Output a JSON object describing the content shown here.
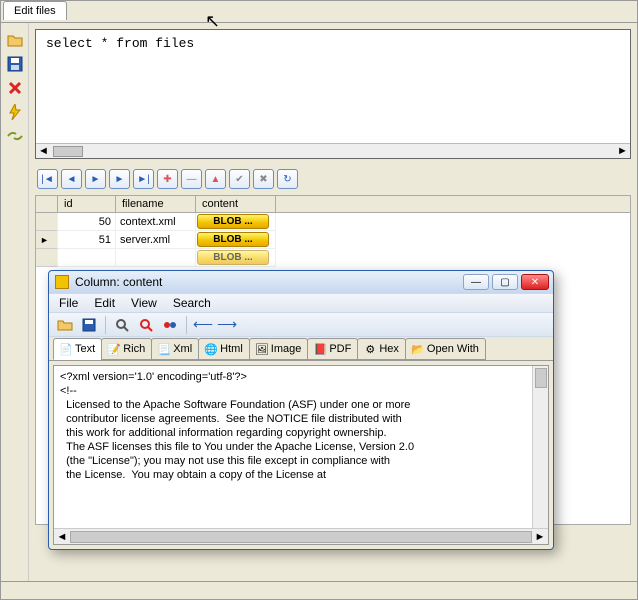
{
  "tab_title": "Edit files",
  "sql": "select * from files",
  "sidebar_icons": [
    "folder-open-icon",
    "save-icon",
    "delete-icon",
    "lightning-icon",
    "refresh-icon"
  ],
  "nav_icons": [
    "first-icon",
    "prev-icon",
    "play-icon",
    "next-icon",
    "last-icon",
    "add-icon",
    "remove-icon",
    "up-icon",
    "confirm-icon",
    "cancel-icon",
    "reload-icon"
  ],
  "grid": {
    "headers": {
      "id": "id",
      "filename": "filename",
      "content": "content"
    },
    "rows": [
      {
        "id": "50",
        "filename": "context.xml",
        "content": "BLOB ..."
      },
      {
        "id": "51",
        "filename": "server.xml",
        "content": "BLOB ..."
      },
      {
        "id": "",
        "filename": "",
        "content": "BLOB ..."
      }
    ]
  },
  "popup": {
    "title": "Column: content",
    "menu": [
      "File",
      "Edit",
      "View",
      "Search"
    ],
    "toolbar_icons": [
      "folder-open-icon",
      "save-icon",
      "find-icon",
      "zoom-icon",
      "link-icon",
      "back-icon",
      "forward-icon"
    ],
    "view_tabs": [
      {
        "icon": "text-icon",
        "label": "Text",
        "active": true
      },
      {
        "icon": "rich-icon",
        "label": "Rich"
      },
      {
        "icon": "xml-icon",
        "label": "Xml"
      },
      {
        "icon": "html-icon",
        "label": "Html"
      },
      {
        "icon": "image-icon",
        "label": "Image"
      },
      {
        "icon": "pdf-icon",
        "label": "PDF"
      },
      {
        "icon": "hex-icon",
        "label": "Hex"
      },
      {
        "icon": "openwith-icon",
        "label": "Open With"
      }
    ],
    "editor_lines": [
      "<?xml version='1.0' encoding='utf-8'?>",
      "<!--",
      "  Licensed to the Apache Software Foundation (ASF) under one or more",
      "  contributor license agreements.  See the NOTICE file distributed with",
      "  this work for additional information regarding copyright ownership.",
      "  The ASF licenses this file to You under the Apache License, Version 2.0",
      "  (the \"License\"); you may not use this file except in compliance with",
      "  the License.  You may obtain a copy of the License at"
    ]
  }
}
